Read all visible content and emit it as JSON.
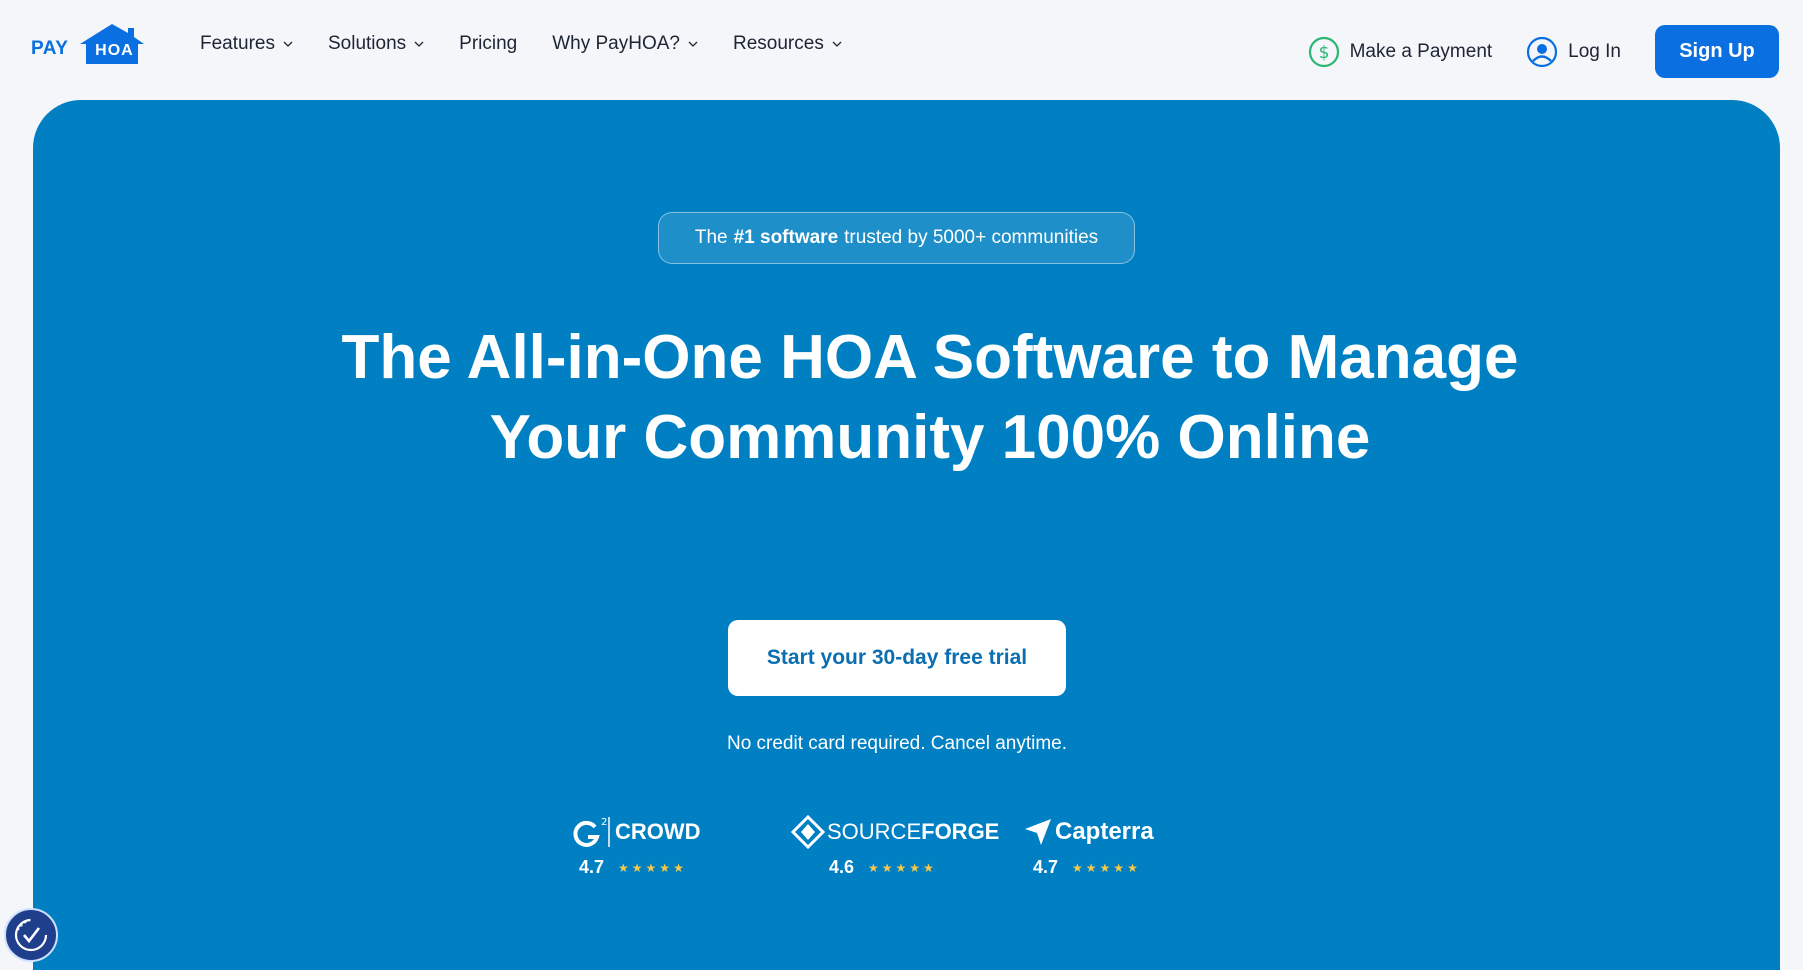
{
  "logo": {
    "pay": "PAY",
    "hoa": "HOA"
  },
  "nav": {
    "items": [
      {
        "label": "Features",
        "dropdown": true
      },
      {
        "label": "Solutions",
        "dropdown": true
      },
      {
        "label": "Pricing",
        "dropdown": false
      },
      {
        "label": "Why PayHOA?",
        "dropdown": true
      },
      {
        "label": "Resources",
        "dropdown": true
      }
    ]
  },
  "header_right": {
    "payment_label": "Make a Payment",
    "login_label": "Log In",
    "signup_label": "Sign Up"
  },
  "hero": {
    "pill_before": "The",
    "pill_bold": "#1 software",
    "pill_after": "trusted by 5000+ communities",
    "headline": "The All-in-One HOA Software to Manage Your Community 100% Online",
    "cta_label": "Start your 30-day free trial",
    "subtext": "No credit card required. Cancel anytime."
  },
  "ratings": [
    {
      "brand": "CROWD",
      "score": "4.7",
      "stars": "★★★★★"
    },
    {
      "brand_a": "SOURCE",
      "brand_b": "FORGE",
      "score": "4.6",
      "stars": "★★★★★"
    },
    {
      "brand": "Capterra",
      "score": "4.7",
      "stars": "★★★★★"
    }
  ],
  "colors": {
    "brand_blue": "#0a6fe0",
    "hero_blue": "#0080c3",
    "star": "#f7c948",
    "payment_green": "#2bb673"
  },
  "icons": [
    "dollar-circle-icon",
    "user-circle-icon",
    "chevron-down-icon",
    "g2-logo-icon",
    "sourceforge-logo-icon",
    "capterra-logo-icon",
    "accessibility-icon"
  ]
}
